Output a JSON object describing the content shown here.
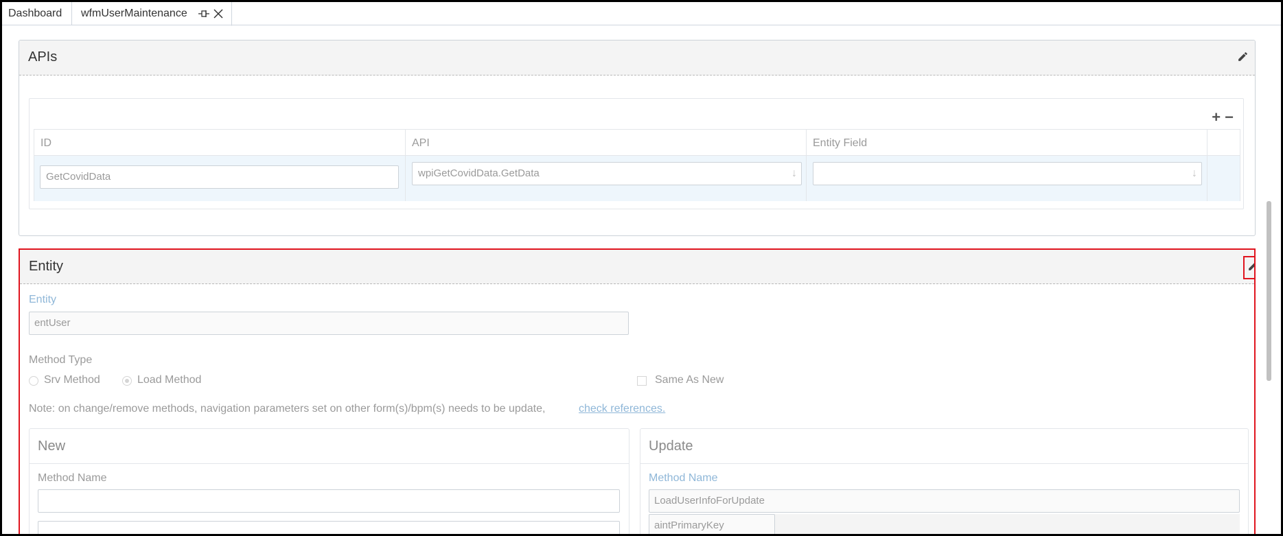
{
  "tabs": {
    "dashboard": "Dashboard",
    "active": "wfmUserMaintenance",
    "pin_icon": "pin-icon",
    "close_icon": "close-icon"
  },
  "apis": {
    "title": "APIs",
    "edit_icon": "pencil-icon",
    "tools": {
      "add": "+",
      "remove": "−"
    },
    "columns": [
      "ID",
      "API",
      "Entity Field"
    ],
    "rows": [
      {
        "id": "GetCovidData",
        "api": "wpiGetCovidData.GetData",
        "entity_field": ""
      }
    ]
  },
  "entity": {
    "title": "Entity",
    "edit_icon": "pencil-icon",
    "entity_label": "Entity",
    "entity_value": "entUser",
    "method_type_label": "Method Type",
    "options": {
      "srv": "Srv Method",
      "load": "Load Method",
      "selected": "Load Method"
    },
    "same_as_new_label": "Same As New",
    "same_as_new_checked": false,
    "note": "Note: on change/remove methods, navigation parameters set on other form(s)/bpm(s) needs to be update,",
    "check_references": "check references.",
    "new": {
      "title": "New",
      "method_name_label": "Method Name",
      "method_name_value": ""
    },
    "update": {
      "title": "Update",
      "method_name_label": "Method Name",
      "method_name_value": "LoadUserInfoForUpdate",
      "param": "aintPrimaryKey"
    }
  },
  "colors": {
    "highlight": "#e0141e",
    "label_blue": "#8fb7d8",
    "row_selected": "#eef6fc"
  }
}
